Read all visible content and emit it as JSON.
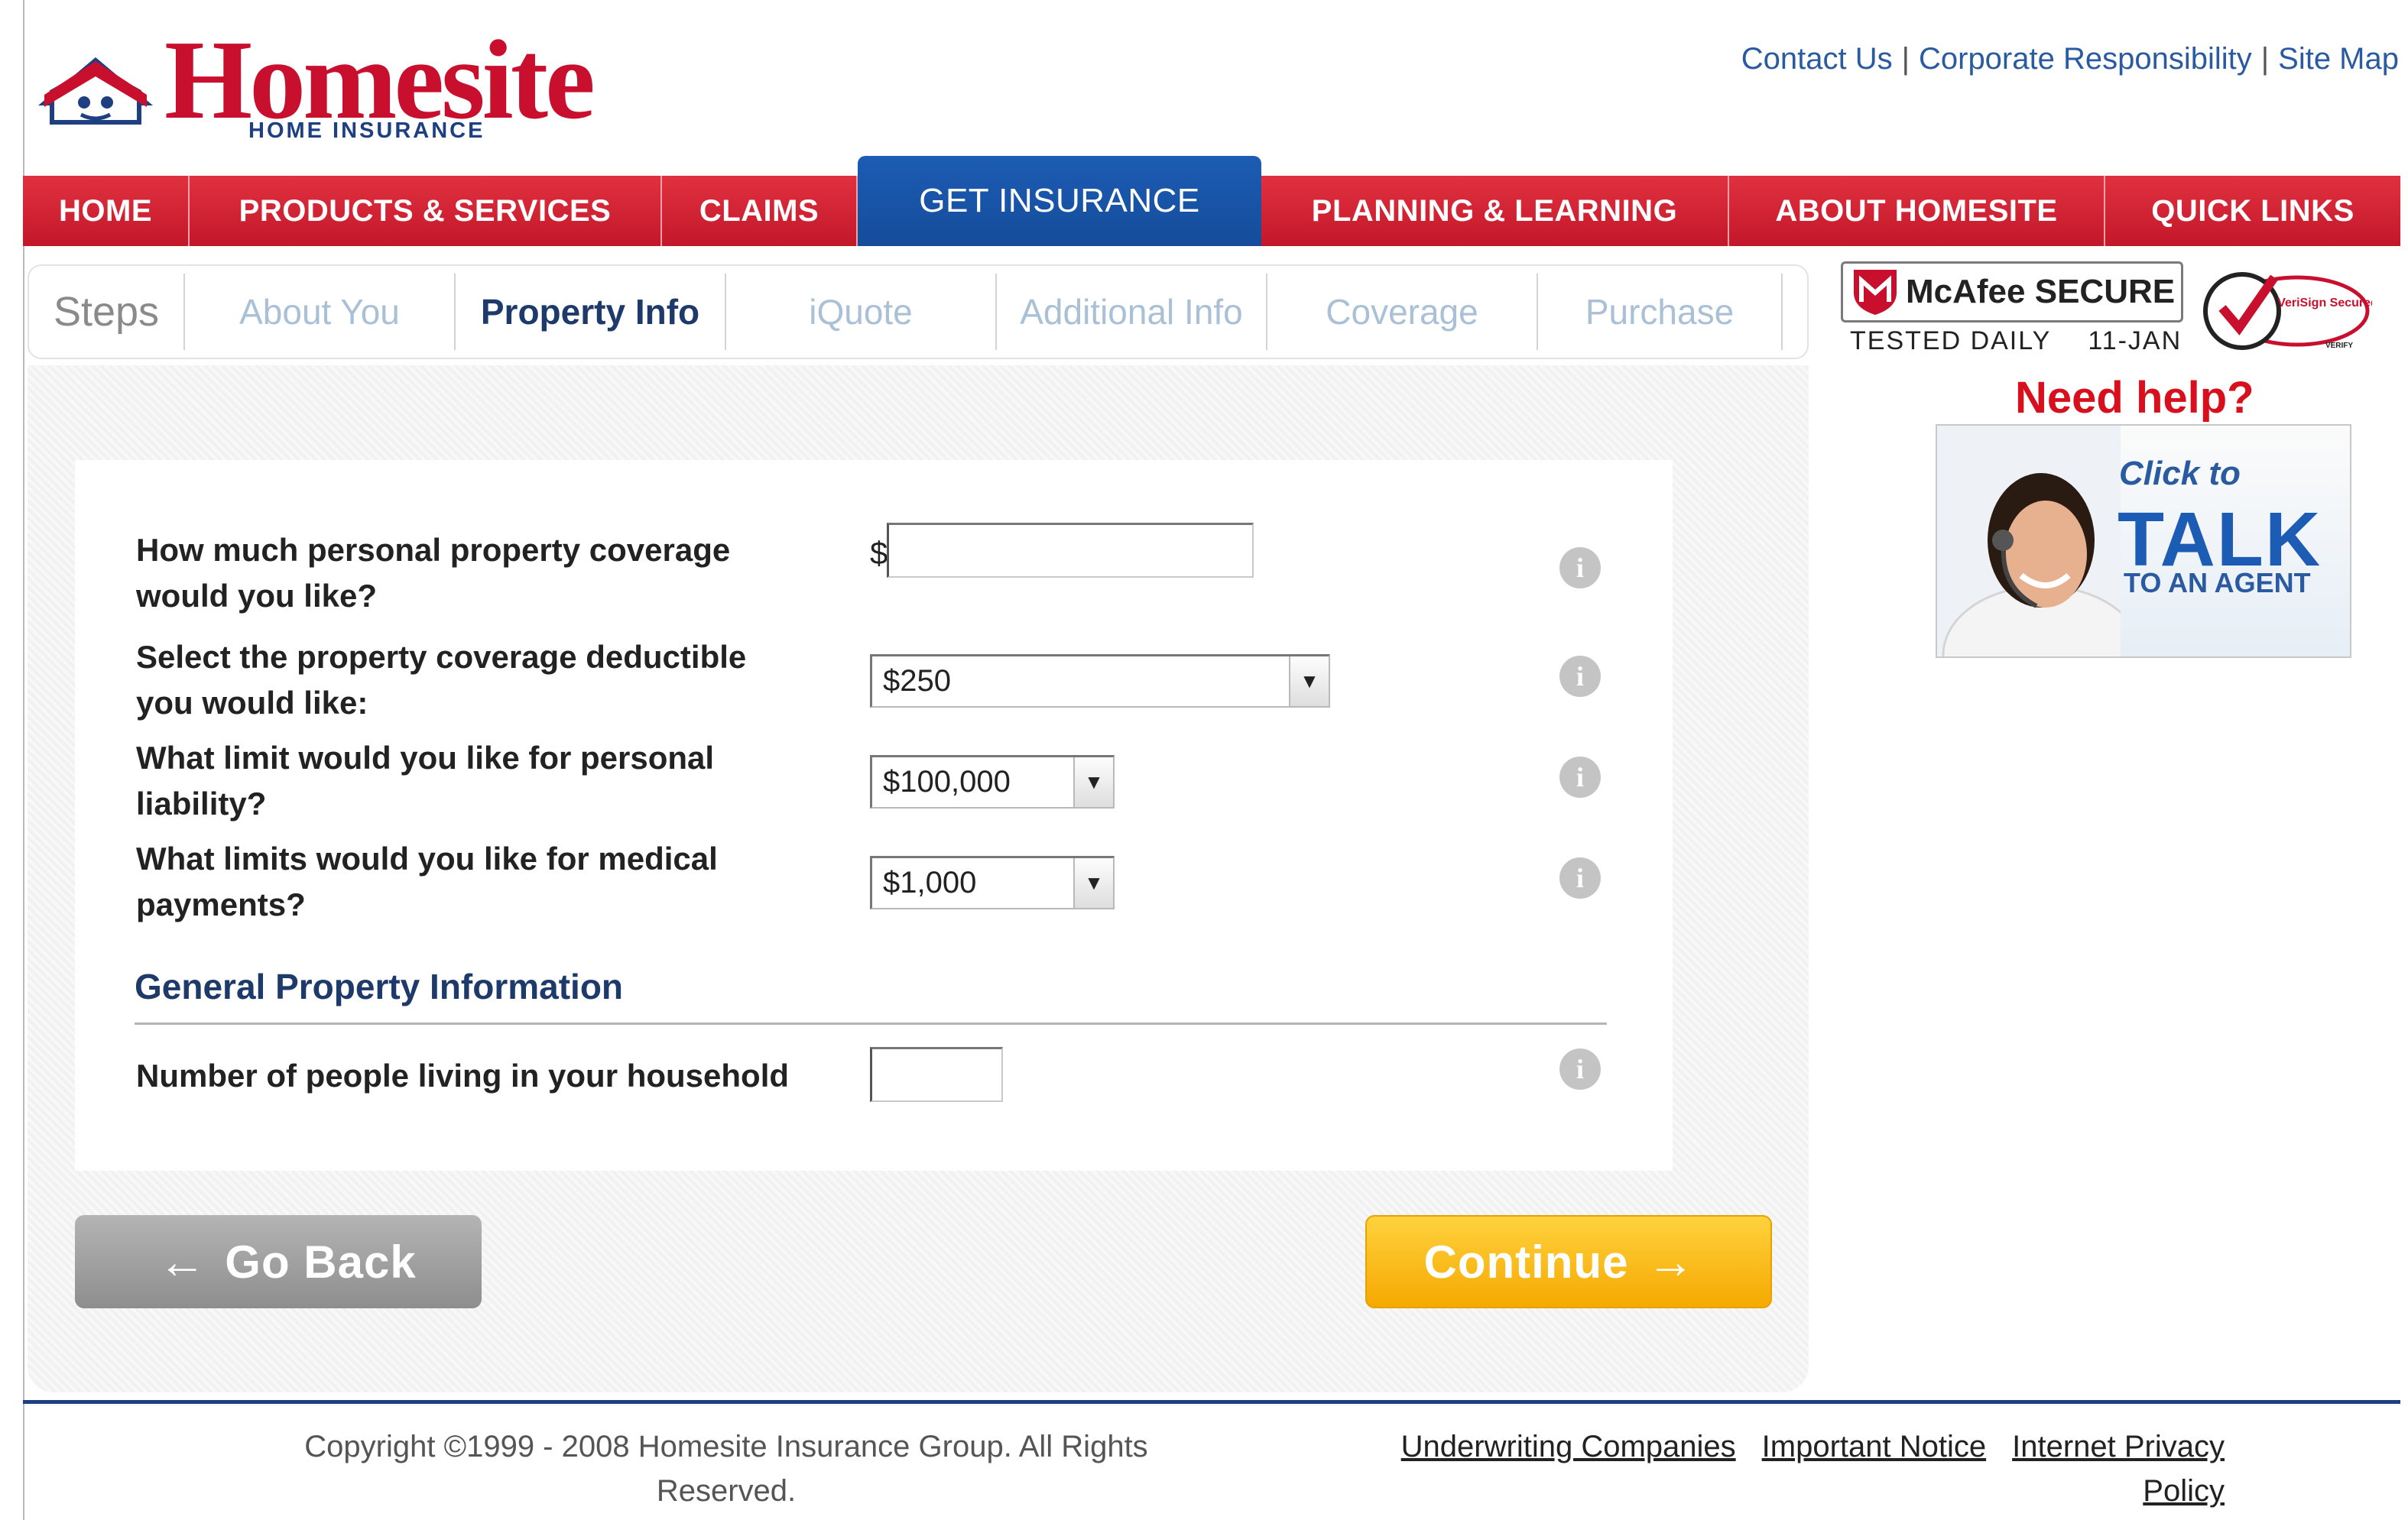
{
  "brand": {
    "name": "Homesite",
    "tagline": "HOME INSURANCE"
  },
  "top_links": [
    "Contact Us",
    "Corporate Responsibility",
    "Site Map"
  ],
  "nav": {
    "items": [
      {
        "label": "HOME"
      },
      {
        "label": "PRODUCTS & SERVICES"
      },
      {
        "label": "CLAIMS"
      },
      {
        "label": "GET INSURANCE",
        "active": true
      },
      {
        "label": "PLANNING & LEARNING"
      },
      {
        "label": "ABOUT HOMESITE"
      },
      {
        "label": "QUICK LINKS"
      }
    ]
  },
  "steps": {
    "label": "Steps",
    "items": [
      "About You",
      "Property Info",
      "iQuote",
      "Additional Info",
      "Coverage",
      "Purchase"
    ],
    "current": "Property Info"
  },
  "security": {
    "mcafee_brand": "McAfee SECURE",
    "tested": "TESTED DAILY",
    "date": "11-JAN",
    "verisign_text": "VeriSign Secured",
    "verisign_sub": "VERIFY"
  },
  "help": {
    "title": "Need help?",
    "click": "Click to",
    "talk": "TALK",
    "agent": "TO AN AGENT"
  },
  "form": {
    "q1": {
      "label_line1": "How much personal property coverage",
      "label_line2": "would you like?",
      "prefix": "$",
      "value": ""
    },
    "q2": {
      "label_line1": "Select the property coverage deductible",
      "label_line2": "you would like:",
      "selected": "$250"
    },
    "q3": {
      "label_line1": "What limit would you like for personal",
      "label_line2": "liability?",
      "selected": "$100,000"
    },
    "q4": {
      "label_line1": "What limits would you like for medical",
      "label_line2": "payments?",
      "selected": "$1,000"
    },
    "section_title": "General Property Information",
    "q5": {
      "label": "Number of people living in your household",
      "value": ""
    },
    "info_glyph": "i"
  },
  "buttons": {
    "back": "Go Back",
    "continue": "Continue"
  },
  "footer": {
    "copyright_line1": "Copyright ©1999 - 2008 Homesite Insurance Group. All Rights",
    "copyright_line2": "Reserved.",
    "links": [
      "Underwriting Companies",
      "Important Notice",
      "Internet Privacy Policy"
    ]
  },
  "colors": {
    "brand_red": "#c8102e",
    "nav_blue": "#1c5cb4",
    "continue_yellow": "#f5a900"
  }
}
